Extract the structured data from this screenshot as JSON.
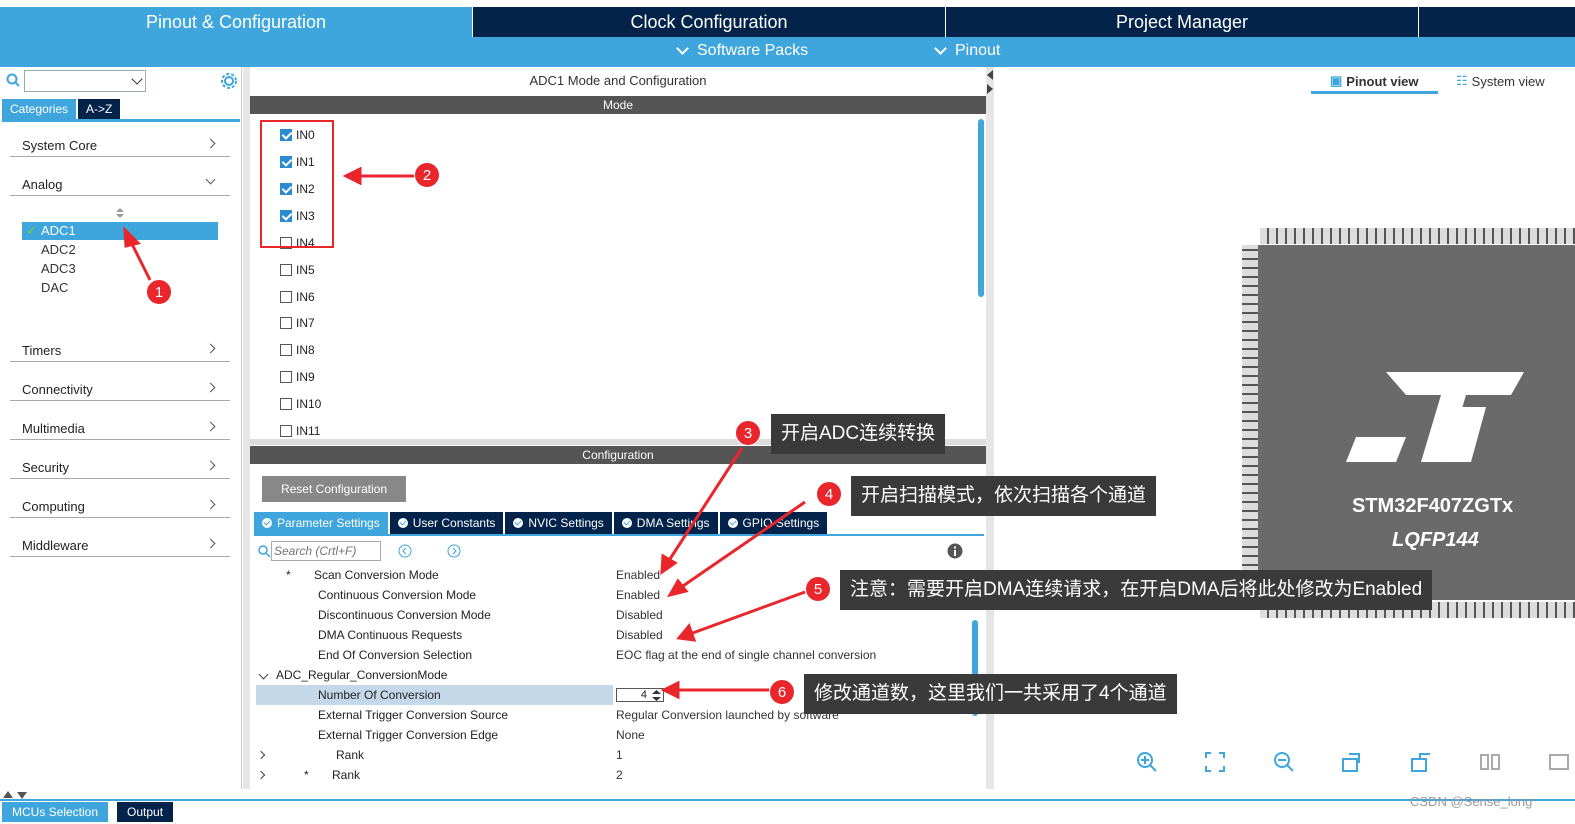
{
  "tabs": {
    "pinout": "Pinout & Configuration",
    "clock": "Clock Configuration",
    "project": "Project Manager"
  },
  "submenu": {
    "software_packs": "Software Packs",
    "pinout": "Pinout"
  },
  "left": {
    "categories_tab": "Categories",
    "az_tab": "A->Z",
    "categories": [
      "System Core",
      "Analog",
      "Timers",
      "Connectivity",
      "Multimedia",
      "Security",
      "Computing",
      "Middleware"
    ],
    "analog_items": [
      "ADC1",
      "ADC2",
      "ADC3",
      "DAC"
    ]
  },
  "mid": {
    "title": "ADC1 Mode and Configuration",
    "mode_header": "Mode",
    "channels": [
      {
        "label": "IN0",
        "checked": true
      },
      {
        "label": "IN1",
        "checked": true
      },
      {
        "label": "IN2",
        "checked": true
      },
      {
        "label": "IN3",
        "checked": true
      },
      {
        "label": "IN4",
        "checked": false
      },
      {
        "label": "IN5",
        "checked": false
      },
      {
        "label": "IN6",
        "checked": false
      },
      {
        "label": "IN7",
        "checked": false
      },
      {
        "label": "IN8",
        "checked": false
      },
      {
        "label": "IN9",
        "checked": false
      },
      {
        "label": "IN10",
        "checked": false
      },
      {
        "label": "IN11",
        "checked": false
      }
    ],
    "config_header": "Configuration",
    "reset_button": "Reset Configuration",
    "config_tabs": [
      "Parameter Settings",
      "User Constants",
      "NVIC Settings",
      "DMA Settings",
      "GPIO Settings"
    ],
    "search_placeholder": "Search (Crtl+F)",
    "params": [
      {
        "name": "Scan Conversion Mode",
        "value": "Enabled"
      },
      {
        "name": "Continuous Conversion Mode",
        "value": "Enabled"
      },
      {
        "name": "Discontinuous Conversion Mode",
        "value": "Disabled"
      },
      {
        "name": "DMA Continuous Requests",
        "value": "Disabled"
      },
      {
        "name": "End Of Conversion Selection",
        "value": "EOC flag at the end of single channel conversion"
      }
    ],
    "group": "ADC_Regular_ConversionMode",
    "group_params": [
      {
        "name": "Number Of Conversion",
        "value": "4"
      },
      {
        "name": "External Trigger Conversion Source",
        "value": "Regular Conversion launched by software"
      },
      {
        "name": "External Trigger Conversion Edge",
        "value": "None"
      },
      {
        "name": "Rank",
        "value": "1"
      },
      {
        "name": "Rank",
        "value": "2"
      }
    ]
  },
  "right": {
    "pinout_view": "Pinout view",
    "system_view": "System view",
    "chip_name": "STM32F407ZGTx",
    "chip_package": "LQFP144"
  },
  "bottom": {
    "mcus_tab": "MCUs Selection",
    "output_tab": "Output",
    "watermark": "CSDN @Sense_long"
  },
  "annotations": [
    {
      "num": "1",
      "text": ""
    },
    {
      "num": "2",
      "text": ""
    },
    {
      "num": "3",
      "text": "开启ADC连续转换"
    },
    {
      "num": "4",
      "text": "开启扫描模式，依次扫描各个通道"
    },
    {
      "num": "5",
      "text": "注意：需要开启DMA连续请求，在开启DMA后将此处修改为Enabled"
    },
    {
      "num": "6",
      "text": "修改通道数，这里我们一共采用了4个通道"
    }
  ],
  "colors": {
    "accent": "#3ea6dd",
    "dark": "#03234b",
    "annotation": "#e8262b"
  }
}
